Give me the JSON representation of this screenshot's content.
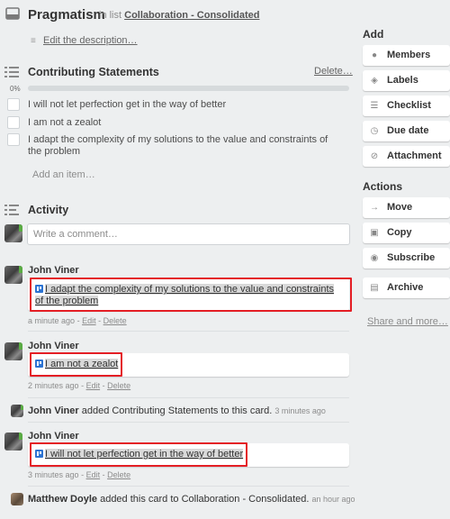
{
  "header": {
    "title": "Pragmatism",
    "in_list_prefix": "in list",
    "list_name": "Collaboration - Consolidated",
    "edit_description": "Edit the description…"
  },
  "checklist": {
    "title": "Contributing Statements",
    "delete_label": "Delete…",
    "progress_label": "0%",
    "progress_fraction": 0,
    "items": [
      {
        "text": "I will not let perfection get in the way of better"
      },
      {
        "text": "I am not a zealot"
      },
      {
        "text": "I adapt the complexity of my solutions to the value and constraints of the problem"
      }
    ],
    "add_item": "Add an item…"
  },
  "activity": {
    "title": "Activity",
    "comment_placeholder": "Write a comment…",
    "entries": [
      {
        "author": "John Viner",
        "text": "I adapt the complexity of my solutions to the value and constraints of the problem",
        "time": "a minute ago",
        "edit": "Edit",
        "delete": "Delete"
      },
      {
        "author": "John Viner",
        "text": "I am not a zealot",
        "time": "2 minutes ago",
        "edit": "Edit",
        "delete": "Delete"
      },
      {
        "author": "John Viner",
        "action": "added Contributing Statements to this card.",
        "time": "3 minutes ago"
      },
      {
        "author": "John Viner",
        "text": "I will not let perfection get in the way of better",
        "time": "3 minutes ago",
        "edit": "Edit",
        "delete": "Delete"
      },
      {
        "author": "Matthew Doyle",
        "action": "added this card to Collaboration - Consolidated.",
        "time": "an hour ago"
      }
    ],
    "meta_separator": "-"
  },
  "sidebar": {
    "add_heading": "Add",
    "add_buttons": [
      {
        "label": "Members",
        "icon": "person-icon"
      },
      {
        "label": "Labels",
        "icon": "tag-icon"
      },
      {
        "label": "Checklist",
        "icon": "checklist-icon"
      },
      {
        "label": "Due date",
        "icon": "clock-icon"
      },
      {
        "label": "Attachment",
        "icon": "paperclip-icon"
      }
    ],
    "actions_heading": "Actions",
    "action_buttons": [
      {
        "label": "Move",
        "icon": "arrow-right-icon"
      },
      {
        "label": "Copy",
        "icon": "copy-icon"
      },
      {
        "label": "Subscribe",
        "icon": "eye-icon"
      },
      {
        "label": "Archive",
        "icon": "archive-icon"
      }
    ],
    "share_more": "Share and more…"
  },
  "colors": {
    "background": "#edeff0",
    "highlight_border": "#e41e25",
    "trello_blue": "#2c73d2",
    "progress_fill": "#5aac44"
  }
}
